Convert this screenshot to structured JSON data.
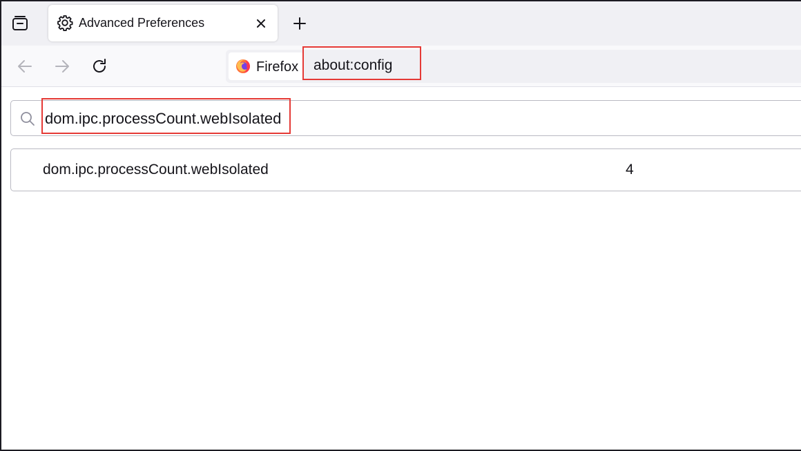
{
  "tab": {
    "title": "Advanced Preferences",
    "icon": "gear-icon"
  },
  "navbar": {
    "identity_label": "Firefox",
    "url": "about:config"
  },
  "search": {
    "value": "dom.ipc.processCount.webIsolated",
    "icon": "search-icon"
  },
  "prefs": [
    {
      "name": "dom.ipc.processCount.webIsolated",
      "value": "4"
    }
  ],
  "colors": {
    "highlight": "#e53935",
    "tabstrip_bg": "#f0f0f4",
    "urlbar_bg": "#f0f0f4",
    "text": "#15141a"
  }
}
